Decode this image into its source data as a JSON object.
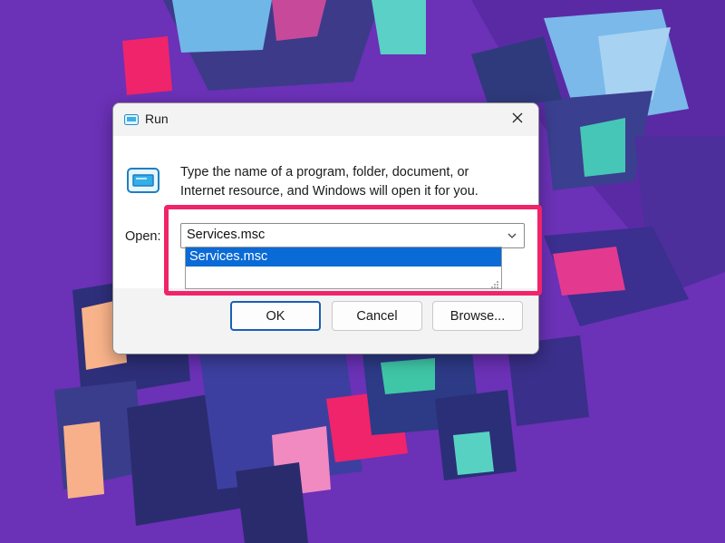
{
  "dialog": {
    "title": "Run",
    "description": "Type the name of a program, folder, document, or Internet resource, and Windows will open it for you.",
    "open_label": "Open:",
    "open_value": "Services.msc",
    "dropdown_items": [
      "Services.msc"
    ],
    "buttons": {
      "ok": "OK",
      "cancel": "Cancel",
      "browse": "Browse..."
    },
    "icons": {
      "title": "run-icon",
      "app": "run-app-icon",
      "close": "close-icon",
      "dropdown": "chevron-down-icon"
    }
  },
  "annotation": {
    "highlight_color": "#f0246a"
  },
  "colors": {
    "selection": "#0a6ad6",
    "primary_border": "#1b5fb5"
  }
}
